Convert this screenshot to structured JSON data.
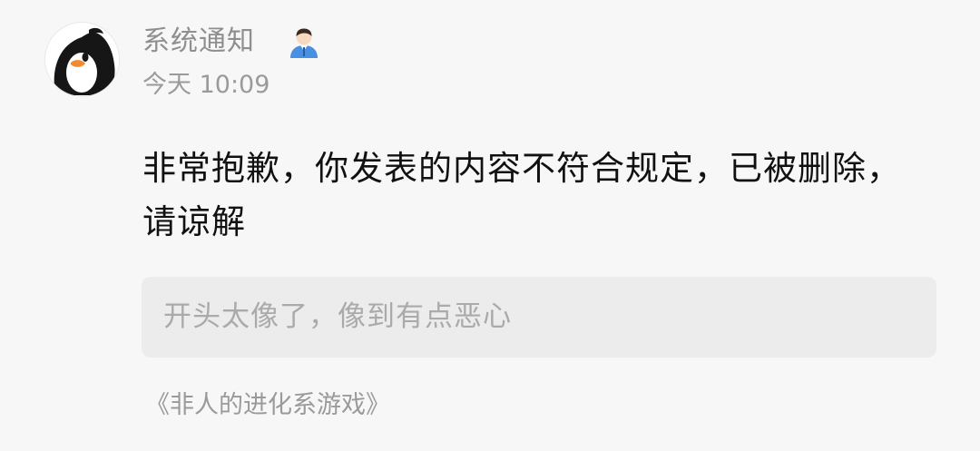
{
  "notification": {
    "sender_name": "系统通知",
    "timestamp": "今天 10:09",
    "message": "非常抱歉，你发表的内容不符合规定，已被删除，请谅解",
    "quoted_content": "开头太像了，像到有点恶心",
    "source": "《非人的进化系游戏》"
  },
  "icons": {
    "avatar": "penguin-avatar-icon",
    "sender_badge": "official-person-icon"
  },
  "colors": {
    "background": "#f7f7f7",
    "message_text": "#111111",
    "secondary_text": "#8f8f8f",
    "quote_background": "#ececec",
    "quote_text": "#aaaaaa"
  }
}
